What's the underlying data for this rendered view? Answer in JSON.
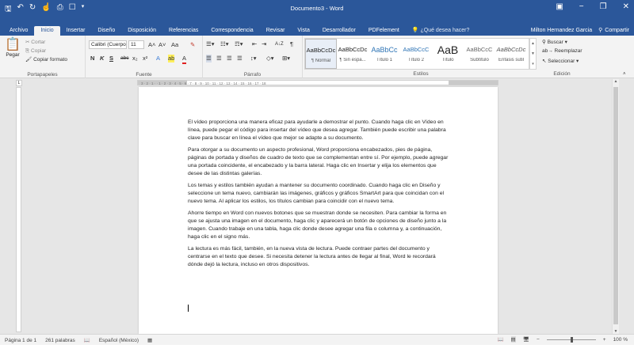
{
  "window": {
    "title": "Documento3 - Word",
    "qat_icons": [
      "save-icon",
      "undo-icon",
      "redo-icon",
      "touch-mode-icon",
      "print-preview-icon",
      "new-document-icon",
      "customize-qat-icon"
    ],
    "controls": [
      "ribbon-display-icon",
      "minimize-icon",
      "restore-icon",
      "close-icon"
    ]
  },
  "tabs": [
    {
      "label": "Archivo",
      "active": false
    },
    {
      "label": "Inicio",
      "active": true
    },
    {
      "label": "Insertar",
      "active": false
    },
    {
      "label": "Diseño",
      "active": false
    },
    {
      "label": "Disposición",
      "active": false
    },
    {
      "label": "Referencias",
      "active": false
    },
    {
      "label": "Correspondencia",
      "active": false
    },
    {
      "label": "Revisar",
      "active": false
    },
    {
      "label": "Vista",
      "active": false
    },
    {
      "label": "Desarrollador",
      "active": false
    },
    {
      "label": "PDFelement",
      "active": false
    }
  ],
  "tell_me": "¿Qué desea hacer?",
  "user": "Milton Hernandez Garcia",
  "share": "Compartir",
  "ribbon": {
    "clipboard": {
      "paste": "Pegar",
      "cut": "Cortar",
      "copy": "Copiar",
      "format_painter": "Copiar formato",
      "group": "Portapapeles"
    },
    "font": {
      "name": "Calibri (Cuerpo",
      "size": "11",
      "grow": "A˄",
      "shrink": "A˅",
      "case": "Aa",
      "clear": "✎",
      "bold": "N",
      "italic": "K",
      "underline": "S",
      "strike": "abc",
      "subscript": "x₂",
      "superscript": "x²",
      "text_effects": "A",
      "highlight": "ab",
      "font_color": "A",
      "group": "Fuente"
    },
    "paragraph": {
      "group": "Párrafo",
      "sort": "A↓Z",
      "pilcrow": "¶"
    },
    "styles": {
      "group": "Estilos",
      "items": [
        {
          "preview": "AaBbCcDc",
          "name": "¶ Normal"
        },
        {
          "preview": "AaBbCcDc",
          "name": "¶ Sin espa..."
        },
        {
          "preview": "AaBbCc",
          "name": "Título 1"
        },
        {
          "preview": "AaBbCcC",
          "name": "Título 2"
        },
        {
          "preview": "AaB",
          "name": "Título"
        },
        {
          "preview": "AaBbCcC",
          "name": "Subtítulo"
        },
        {
          "preview": "AaBbCcDc",
          "name": "Énfasis sutil"
        }
      ]
    },
    "editing": {
      "group": "Edición",
      "find": "Buscar",
      "replace": "Reemplazar",
      "select": "Seleccionar"
    }
  },
  "document": {
    "paragraphs": [
      "El vídeo proporciona una manera eficaz para ayudarle a demostrar el punto. Cuando haga clic en Vídeo en línea, puede pegar el código para insertar del vídeo que desea agregar. También puede escribir una palabra clave para buscar en línea el vídeo que mejor se adapte a su documento.",
      "Para otorgar a su documento un aspecto profesional, Word proporciona encabezados, pies de página, páginas de portada y diseños de cuadro de texto que se complementan entre sí. Por ejemplo, puede agregar una portada coincidente, el encabezado y la barra lateral. Haga clic en Insertar y elija los elementos que desee de las distintas galerías.",
      "Los temas y estilos también ayudan a mantener su documento coordinado. Cuando haga clic en Diseño y seleccione un tema nuevo, cambiarán las imágenes, gráficos y gráficos SmartArt para que coincidan con el nuevo tema. Al aplicar los estilos, los títulos cambian para coincidir con el nuevo tema.",
      "Ahorre tiempo en Word con nuevos botones que se muestran donde se necesiten. Para cambiar la forma en que se ajusta una imagen en el documento, haga clic y aparecerá un botón de opciones de diseño junto a la imagen. Cuando trabaje en una tabla, haga clic donde desee agregar una fila o columna y, a continuación, haga clic en el signo más.",
      "La lectura es más fácil, también, en la nueva vista de lectura. Puede contraer partes del documento y centrarse en el texto que desee. Si necesita detener la lectura antes de llegar al final, Word le recordará dónde dejó la lectura, incluso en otros dispositivos."
    ]
  },
  "ruler": "3 · 2 · 1 · · 1 · 2 · 3 · 4 · 5 · 6 · 7 · 8 · 9 · 10 · 11 · 12 · 13 · 14 · 15 · 16 · 17 · 18",
  "status": {
    "page": "Página 1 de 1",
    "words": "261 palabras",
    "language": "Español (México)",
    "zoom": "100 %"
  },
  "colors": {
    "word_blue": "#2b579a",
    "ribbon_bg": "#f3f3f3",
    "workspace": "#e6e6e6"
  }
}
